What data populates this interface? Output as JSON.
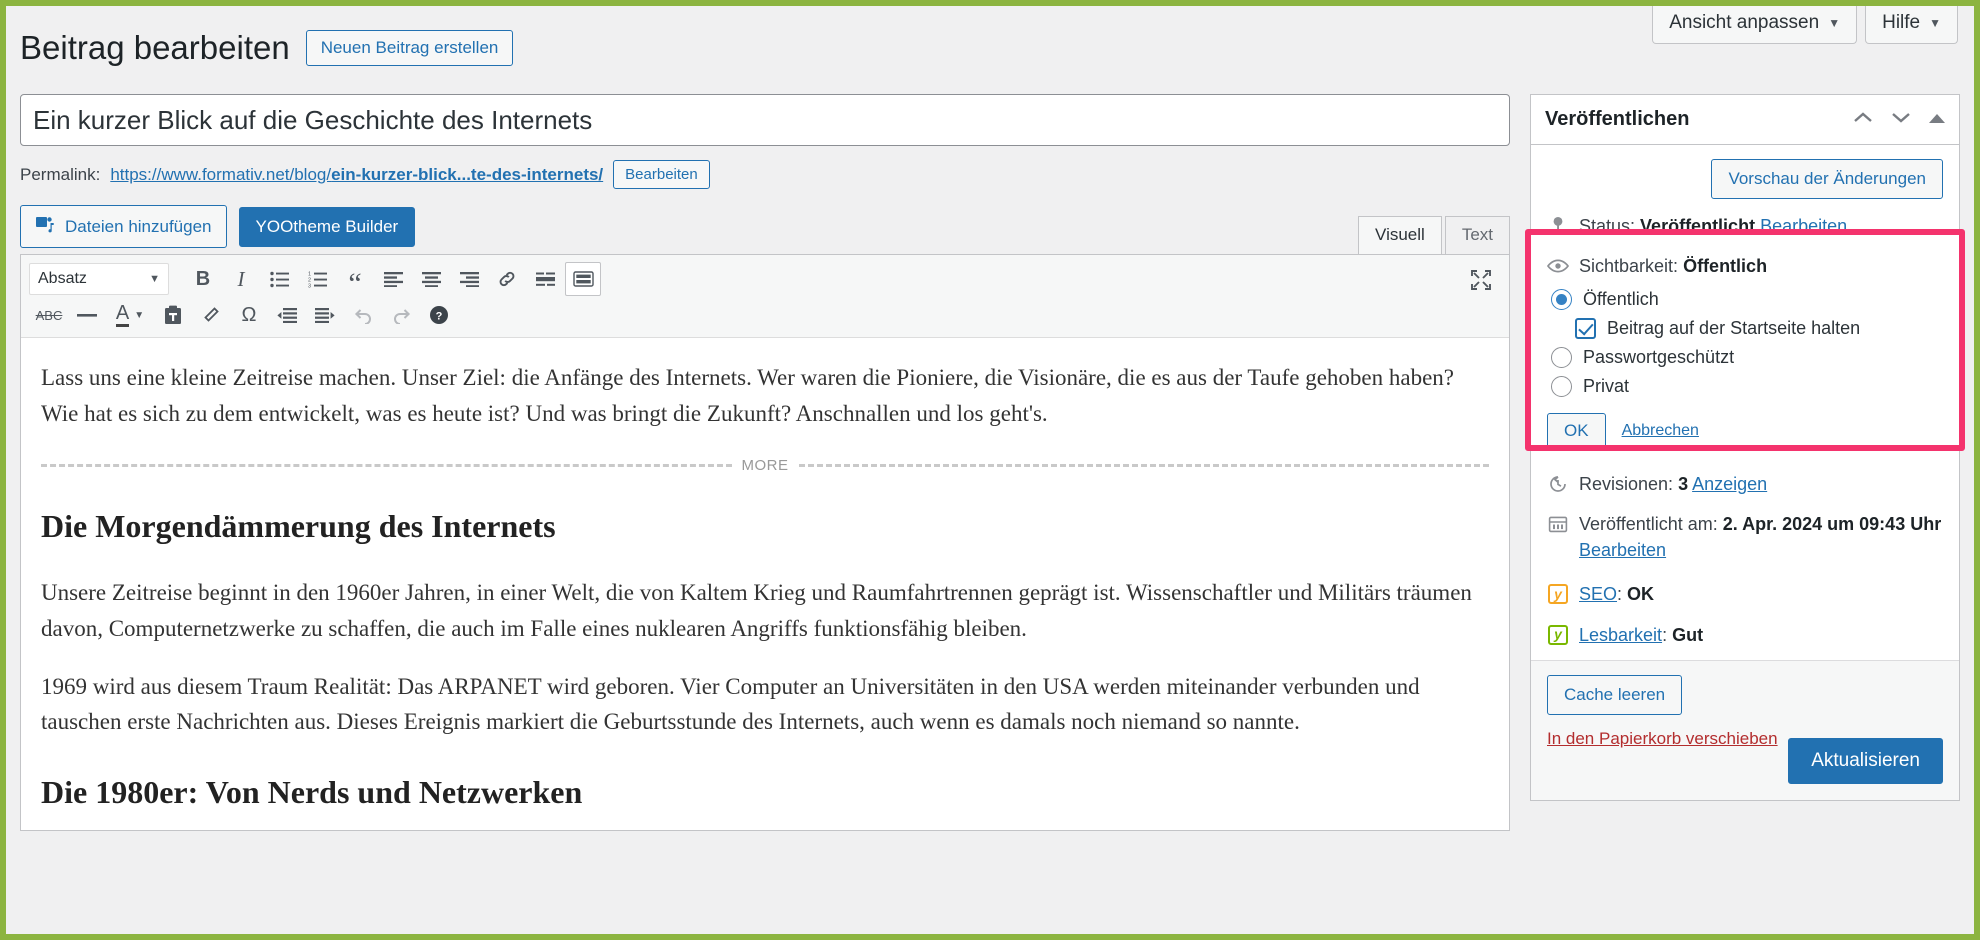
{
  "topbar": {
    "screen_options": "Ansicht anpassen",
    "help": "Hilfe",
    "caret": "▼"
  },
  "header": {
    "page_title": "Beitrag bearbeiten",
    "add_new_button": "Neuen Beitrag erstellen"
  },
  "post": {
    "title": "Ein kurzer Blick auf die Geschichte des Internets",
    "permalink_label": "Permalink:",
    "permalink_base": "https://www.formativ.net/blog/",
    "permalink_slug": "ein-kurzer-blick...te-des-internets/",
    "edit_slug_button": "Bearbeiten"
  },
  "media": {
    "add_media_button": "Dateien hinzufügen",
    "yootheme_button": "YOOtheme Builder"
  },
  "editor_tabs": {
    "visual": "Visuell",
    "text": "Text",
    "active": "Visuell"
  },
  "toolbar": {
    "format_select": "Absatz",
    "caret": "▼",
    "row1": [
      {
        "name": "bold-icon",
        "glyph": "B"
      },
      {
        "name": "italic-icon",
        "glyph": "I"
      },
      {
        "name": "bullet-list-icon",
        "glyph": ""
      },
      {
        "name": "numbered-list-icon",
        "glyph": ""
      },
      {
        "name": "blockquote-icon",
        "glyph": "“"
      },
      {
        "name": "align-left-icon",
        "glyph": ""
      },
      {
        "name": "align-center-icon",
        "glyph": ""
      },
      {
        "name": "align-right-icon",
        "glyph": ""
      },
      {
        "name": "insert-link-icon",
        "glyph": ""
      },
      {
        "name": "read-more-icon",
        "glyph": ""
      },
      {
        "name": "toggle-toolbar-icon",
        "glyph": ""
      }
    ],
    "row2": [
      {
        "name": "strikethrough-icon",
        "glyph": "ABC"
      },
      {
        "name": "horizontal-rule-icon",
        "glyph": "—"
      },
      {
        "name": "text-color-icon",
        "glyph": "A"
      },
      {
        "name": "paste-as-text-icon",
        "glyph": ""
      },
      {
        "name": "clear-formatting-icon",
        "glyph": ""
      },
      {
        "name": "special-character-icon",
        "glyph": "Ω"
      },
      {
        "name": "outdent-icon",
        "glyph": ""
      },
      {
        "name": "indent-icon",
        "glyph": ""
      },
      {
        "name": "undo-icon",
        "glyph": "↶"
      },
      {
        "name": "redo-icon",
        "glyph": "↷"
      },
      {
        "name": "keyboard-shortcuts-icon",
        "glyph": "?"
      }
    ],
    "fullscreen_icon": "fullscreen-icon"
  },
  "content": {
    "intro_paragraph": "Lass uns eine kleine Zeitreise machen. Unser Ziel: die Anfänge des Internets. Wer waren die Pioniere, die Visionäre, die es aus der Taufe gehoben haben? Wie hat es sich zu dem entwickelt, was es heute ist? Und was bringt die Zukunft? Anschnallen und los geht's.",
    "more_label": "MORE",
    "heading_1": "Die Morgendämmerung des Internets",
    "paragraph_1": "Unsere Zeitreise beginnt in den 1960er Jahren, in einer Welt, die von Kaltem Krieg und Raumfahrtrennen geprägt ist. Wissenschaftler und Militärs träumen davon, Computernetzwerke zu schaffen, die auch im Falle eines nuklearen Angriffs funktionsfähig bleiben.",
    "paragraph_2": "1969 wird aus diesem Traum Realität: Das ARPANET wird geboren. Vier Computer an Universitäten in den USA werden miteinander verbunden und tauschen erste Nachrichten aus. Dieses Ereignis markiert die Geburtsstunde des Internets, auch wenn es damals noch niemand so nannte.",
    "heading_2": "Die 1980er: Von Nerds und Netzwerken"
  },
  "publish_panel": {
    "title": "Veröffentlichen",
    "collapse_up_icon": "▲",
    "collapse_down_icon": "▼",
    "toggle_icon": "▲",
    "preview_button": "Vorschau der Änderungen",
    "status_label": "Status:",
    "status_value": "Veröffentlicht",
    "status_edit_link": "Bearbeiten",
    "visibility_label": "Sichtbarkeit:",
    "visibility_value": "Öffentlich",
    "visibility_options": [
      {
        "label": "Öffentlich",
        "selected": true
      },
      {
        "label": "Passwortgeschützt",
        "selected": false
      },
      {
        "label": "Privat",
        "selected": false
      }
    ],
    "sticky_checkbox_label": "Beitrag auf der Startseite halten",
    "ok_button": "OK",
    "cancel_link": "Abbrechen",
    "revisions_label": "Revisionen:",
    "revisions_count": "3",
    "revisions_link": "Anzeigen",
    "published_label": "Veröffentlicht am:",
    "published_value": "2. Apr. 2024 um 09:43 Uhr",
    "published_edit_link": "Bearbeiten",
    "seo_label": "SEO",
    "seo_value": "OK",
    "readability_label": "Lesbarkeit",
    "readability_value": "Gut",
    "cache_button": "Cache leeren",
    "trash_link": "In den Papierkorb verschieben",
    "update_button": "Aktualisieren"
  },
  "colors": {
    "accent_blue": "#2271b1",
    "highlight_pink": "#f4336d",
    "frame_green": "#8cb440",
    "trash_red": "#b32d2e",
    "yoast_orange": "#f5a623",
    "yoast_green": "#7ab800"
  }
}
